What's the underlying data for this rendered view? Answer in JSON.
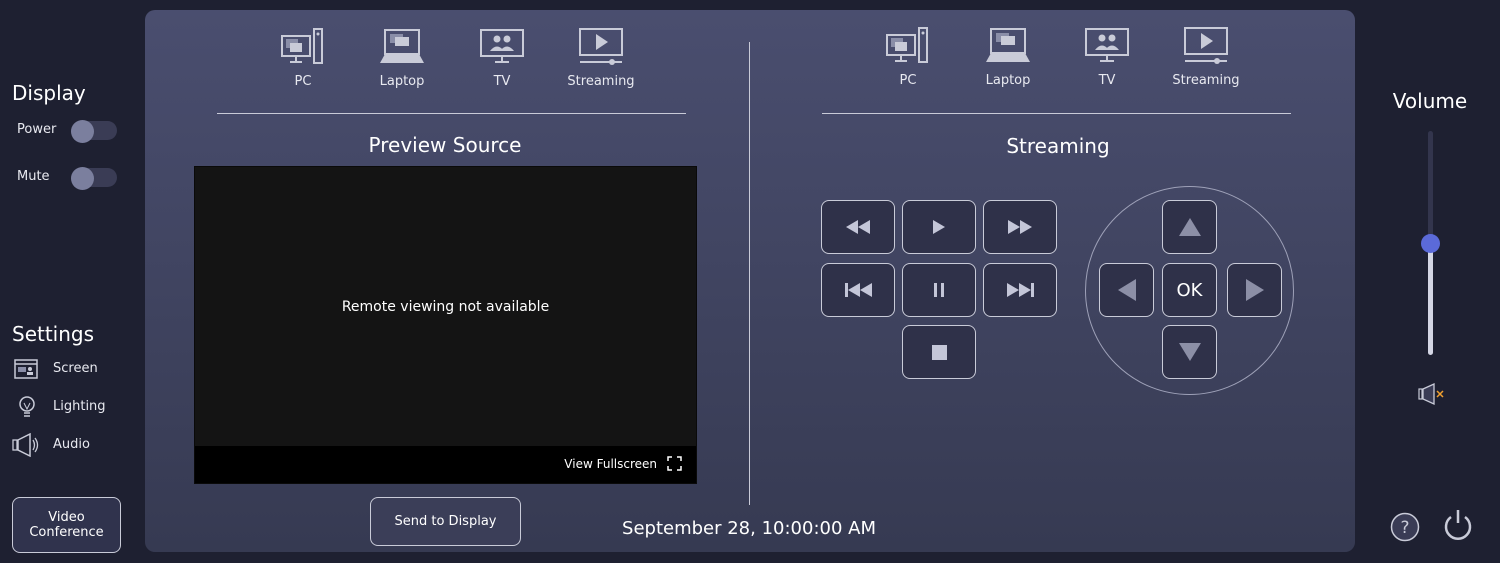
{
  "sidebar": {
    "display_heading": "Display",
    "power_label": "Power",
    "power_on": false,
    "mute_label": "Mute",
    "mute_on": false,
    "settings_heading": "Settings",
    "settings_items": [
      {
        "label": "Screen",
        "icon": "screen-icon"
      },
      {
        "label": "Lighting",
        "icon": "lightbulb-icon"
      },
      {
        "label": "Audio",
        "icon": "speaker-icon"
      }
    ],
    "video_conference_label": "Video Conference"
  },
  "left": {
    "sources": [
      {
        "label": "PC",
        "icon": "pc-icon"
      },
      {
        "label": "Laptop",
        "icon": "laptop-icon"
      },
      {
        "label": "TV",
        "icon": "tv-icon"
      },
      {
        "label": "Streaming",
        "icon": "streaming-icon"
      }
    ],
    "title": "Preview Source",
    "preview_message": "Remote viewing not available",
    "fullscreen_label": "View Fullscreen",
    "send_label": "Send to Display"
  },
  "right": {
    "sources": [
      {
        "label": "PC",
        "icon": "pc-icon"
      },
      {
        "label": "Laptop",
        "icon": "laptop-icon"
      },
      {
        "label": "TV",
        "icon": "tv-icon"
      },
      {
        "label": "Streaming",
        "icon": "streaming-icon"
      }
    ],
    "title": "Streaming",
    "ok_label": "OK"
  },
  "datetime": "September 28, 10:00:00 AM",
  "volume": {
    "heading": "Volume",
    "level_percent": 50,
    "muted": true
  },
  "colors": {
    "accent": "#5b6ad8",
    "mute_x": "#f0a030",
    "background": "#1e2031"
  }
}
